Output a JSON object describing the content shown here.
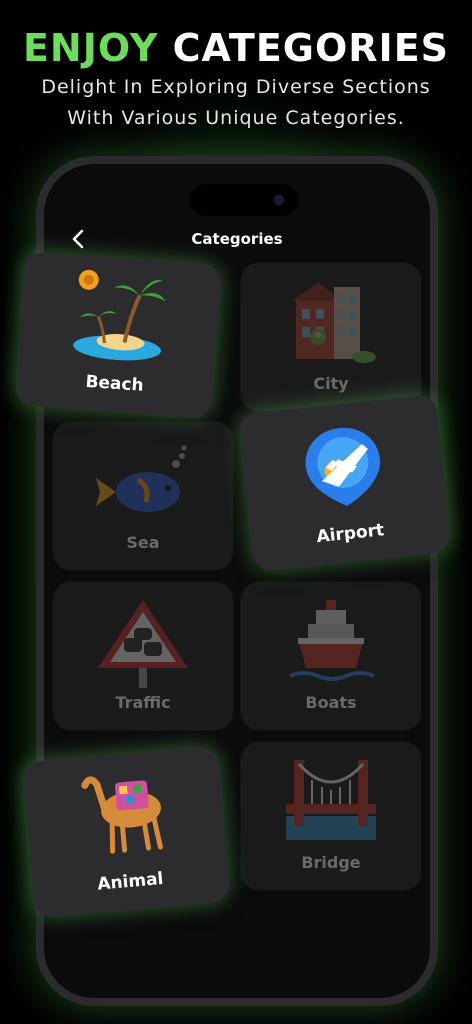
{
  "promo": {
    "headline_accent": "ENJOY",
    "headline_rest": "CATEGORIES",
    "subtitle_line1": "Delight In Exploring Diverse Sections",
    "subtitle_line2": "With Various Unique Categories."
  },
  "screen": {
    "back_icon": "chevron-left-icon",
    "title": "Categories"
  },
  "categories": [
    {
      "label": "Beach",
      "icon": "beach-island-icon",
      "highlighted": true
    },
    {
      "label": "City",
      "icon": "city-building-icon",
      "highlighted": false
    },
    {
      "label": "Sea",
      "icon": "fish-icon",
      "highlighted": false
    },
    {
      "label": "Airport",
      "icon": "airplane-pin-icon",
      "highlighted": true
    },
    {
      "label": "Traffic",
      "icon": "traffic-sign-icon",
      "highlighted": false
    },
    {
      "label": "Boats",
      "icon": "ship-icon",
      "highlighted": false
    },
    {
      "label": "Animal",
      "icon": "camel-icon",
      "highlighted": true
    },
    {
      "label": "Bridge",
      "icon": "bridge-icon",
      "highlighted": false
    }
  ],
  "colors": {
    "accent": "#6ddc5c",
    "card_bg": "#1a1a1b",
    "card_highlight_bg": "#2c2c2e",
    "dim_label": "#6a6a6a"
  }
}
